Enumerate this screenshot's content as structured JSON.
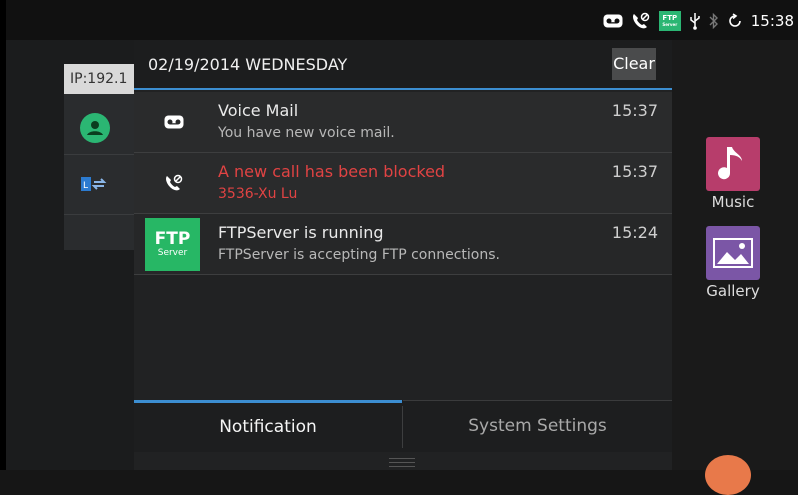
{
  "status_bar": {
    "time": "15:38",
    "ftp_icon_text": "FTP",
    "ftp_icon_sub": "Server",
    "icons": [
      "voicemail-icon",
      "call-blocked-icon",
      "ftp-server-icon",
      "usb-icon",
      "bluetooth-icon",
      "sync-icon"
    ]
  },
  "background": {
    "ip_label": "IP:192.1",
    "apps": [
      {
        "label": "Music",
        "icon": "music-note-icon",
        "color": "#b73d6b"
      },
      {
        "label": "Gallery",
        "icon": "gallery-icon",
        "color": "#7b56a6"
      }
    ]
  },
  "shade": {
    "date": "02/19/2014 WEDNESDAY",
    "clear_label": "Clear",
    "accent": "#3c8ed1",
    "notifications": [
      {
        "title": "Voice Mail",
        "text": "You have new voice mail.",
        "time": "15:37",
        "icon": "voicemail-icon"
      },
      {
        "title": "A new call has been blocked",
        "text": "3536-Xu Lu",
        "time": "15:37",
        "icon": "call-blocked-icon",
        "color": "#e04343"
      },
      {
        "title": "FTPServer is running",
        "text": "FTPServer is accepting FTP connections.",
        "time": "15:24",
        "icon": "ftp-server-icon",
        "icon_text": "FTP",
        "icon_sub": "Server"
      }
    ],
    "tabs": [
      {
        "label": "Notification",
        "active": true
      },
      {
        "label": "System Settings",
        "active": false
      }
    ]
  }
}
